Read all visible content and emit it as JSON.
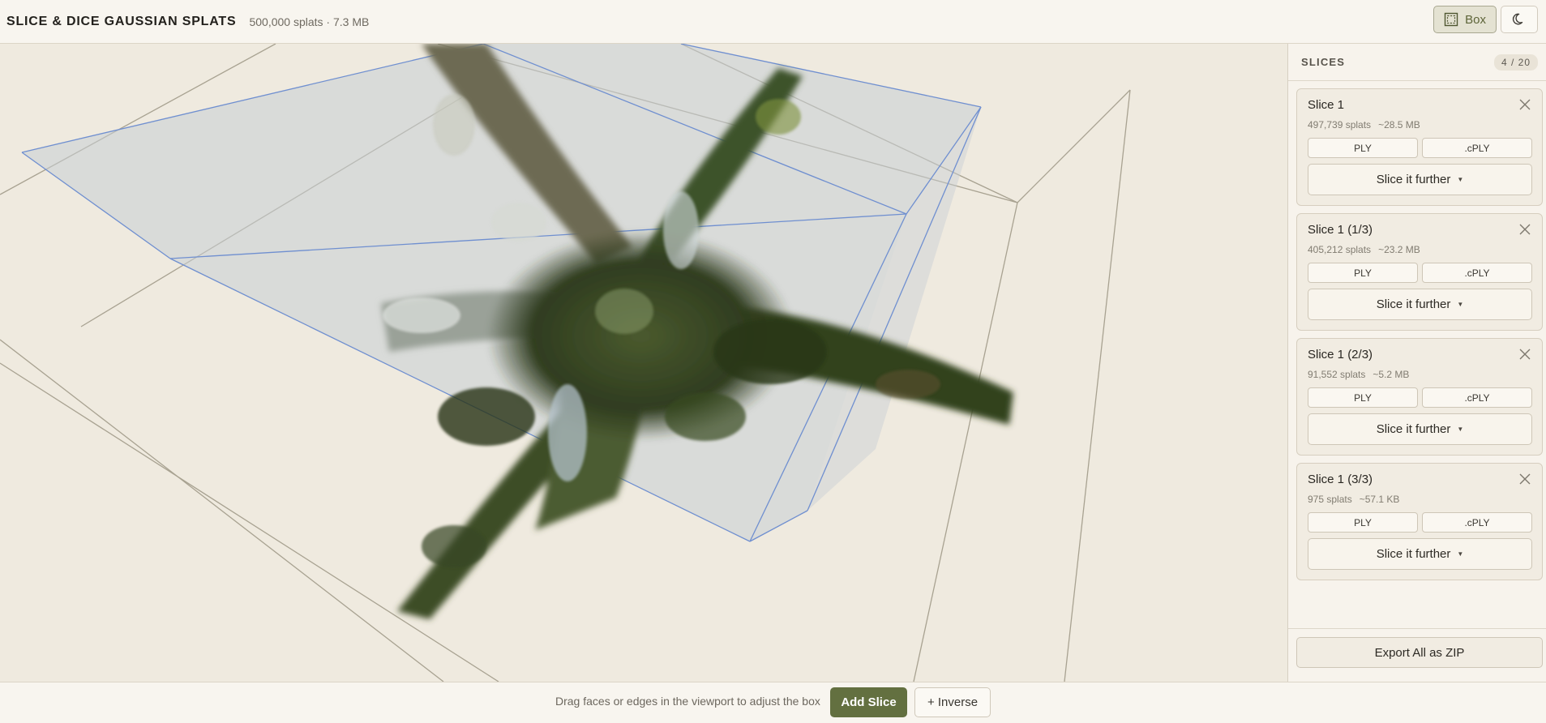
{
  "header": {
    "title": "SLICE & DICE GAUSSIAN SPLATS",
    "file_info": "500,000 splats · 7.3 MB",
    "mode_label": "Box",
    "mode_icon": "box-select-icon",
    "theme_icon": "moon-icon"
  },
  "sidebar": {
    "title": "SLICES",
    "count": "4 / 20",
    "slices": [
      {
        "name": "Slice 1",
        "splats": "497,739 splats",
        "size": "~28.5 MB",
        "ply": "PLY",
        "cply": ".cPLY",
        "further": "Slice it further"
      },
      {
        "name": "Slice 1 (1/3)",
        "splats": "405,212 splats",
        "size": "~23.2 MB",
        "ply": "PLY",
        "cply": ".cPLY",
        "further": "Slice it further"
      },
      {
        "name": "Slice 1 (2/3)",
        "splats": "91,552 splats",
        "size": "~5.2 MB",
        "ply": "PLY",
        "cply": ".cPLY",
        "further": "Slice it further"
      },
      {
        "name": "Slice 1 (3/3)",
        "splats": "975 splats",
        "size": "~57.1 KB",
        "ply": "PLY",
        "cply": ".cPLY",
        "further": "Slice it further"
      }
    ],
    "export_label": "Export All as ZIP"
  },
  "footer": {
    "hint": "Drag faces or edges in the viewport to adjust the box",
    "add_label": "Add Slice",
    "inverse_label": "+ Inverse"
  },
  "colors": {
    "accent": "#637040",
    "box_edge": "#6f8fd0",
    "background": "#efeadf"
  }
}
